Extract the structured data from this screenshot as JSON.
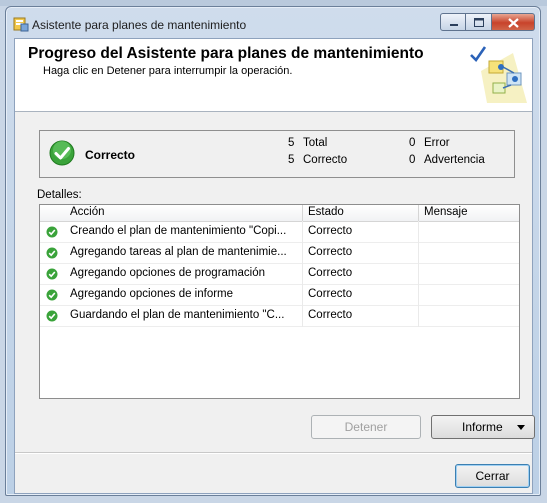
{
  "window": {
    "title": "Asistente para planes de mantenimiento"
  },
  "header": {
    "title": "Progreso del Asistente para planes de mantenimiento",
    "subtitle": "Haga clic en Detener para interrumpir la operación."
  },
  "status": {
    "label": "Correcto",
    "total_count": "5",
    "total_label": "Total",
    "success_count": "5",
    "success_label": "Correcto",
    "error_count": "0",
    "error_label": "Error",
    "warning_count": "0",
    "warning_label": "Advertencia"
  },
  "details": {
    "label": "Detalles:",
    "columns": [
      "Acción",
      "Estado",
      "Mensaje"
    ],
    "rows": [
      {
        "action": "Creando el plan de mantenimiento \"Copi...",
        "state": "Correcto",
        "message": ""
      },
      {
        "action": "Agregando tareas al plan de mantenimie...",
        "state": "Correcto",
        "message": ""
      },
      {
        "action": "Agregando opciones de programación",
        "state": "Correcto",
        "message": ""
      },
      {
        "action": "Agregando opciones de informe",
        "state": "Correcto",
        "message": ""
      },
      {
        "action": "Guardando el plan de mantenimiento \"C...",
        "state": "Correcto",
        "message": ""
      }
    ]
  },
  "buttons": {
    "stop": "Detener",
    "report": "Informe",
    "close": "Cerrar"
  },
  "colors": {
    "success_green": "#3aa33a",
    "close_red": "#c8432b"
  },
  "icons": {
    "app": "maintenance-plan-icon",
    "status": "success-check-icon",
    "header": "wizard-graphic-icon"
  }
}
